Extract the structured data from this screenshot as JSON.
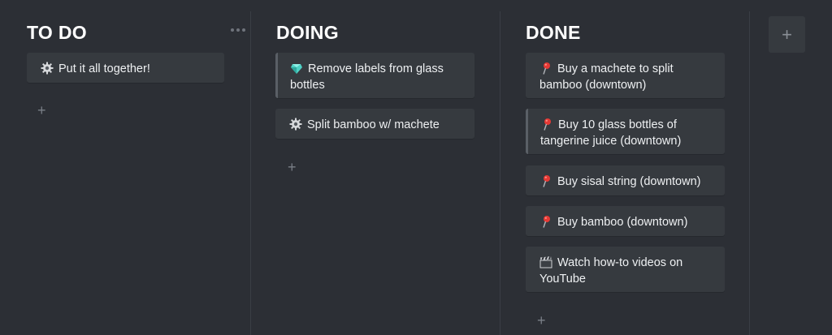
{
  "columns": [
    {
      "title": "TO DO",
      "cards": [
        {
          "icon": "gear-icon",
          "text": "Put it all together!"
        }
      ]
    },
    {
      "title": "DOING",
      "cards": [
        {
          "icon": "gem-icon",
          "text": "Remove labels from glass bottles"
        },
        {
          "icon": "gear-icon",
          "text": "Split bamboo w/ machete"
        }
      ]
    },
    {
      "title": "DONE",
      "cards": [
        {
          "icon": "pushpin-icon",
          "text": "Buy a machete to split bamboo (downtown)"
        },
        {
          "icon": "pushpin-icon",
          "text": "Buy 10 glass bottles of tangerine juice (downtown)"
        },
        {
          "icon": "pushpin-icon",
          "text": "Buy sisal string (downtown)"
        },
        {
          "icon": "pushpin-icon",
          "text": "Buy bamboo (downtown)"
        },
        {
          "icon": "clapperboard-icon",
          "text": "Watch how-to videos on YouTube"
        }
      ]
    }
  ],
  "add_card_symbol": "+",
  "add_column_symbol": "+",
  "colors": {
    "background": "#2c2f35",
    "card": "#363a3f",
    "text": "#eef0f2",
    "muted": "#7a7f87"
  }
}
